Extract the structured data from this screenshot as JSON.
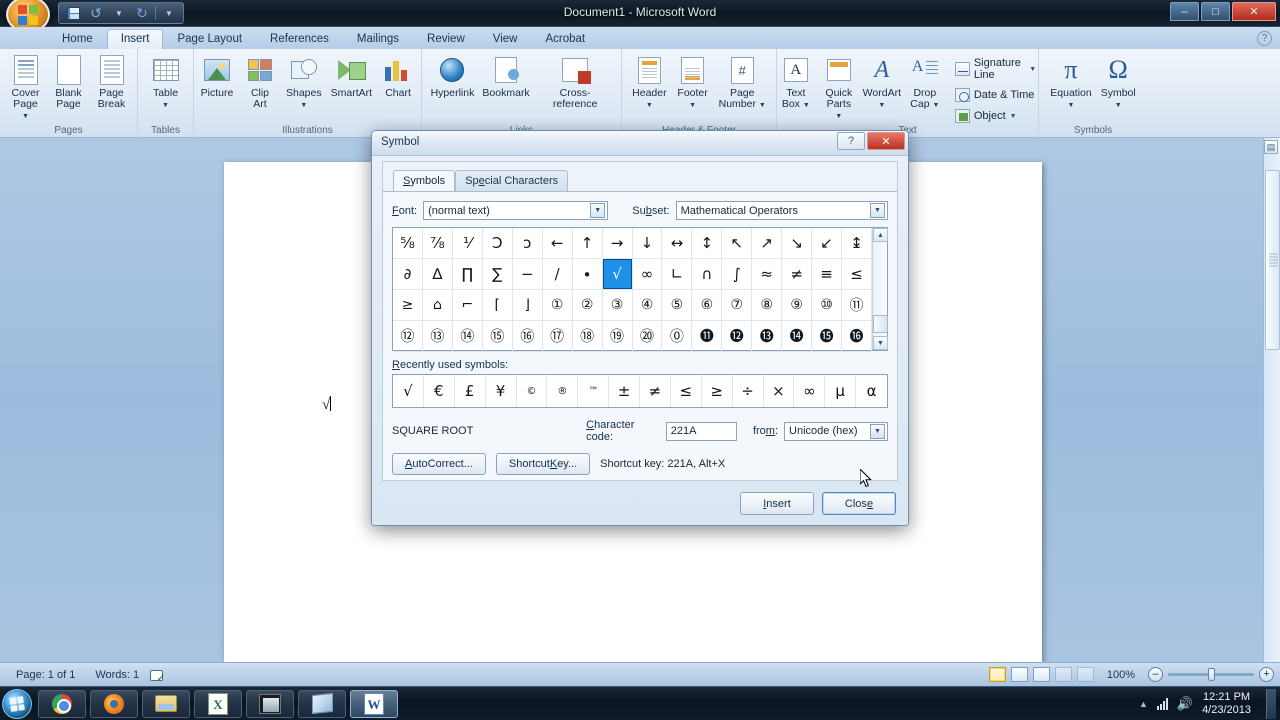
{
  "window": {
    "title": "Document1 - Microsoft Word",
    "minimize": "–",
    "maximize": "□",
    "close": "✕",
    "help": "?"
  },
  "quick_access": {
    "save": "save-icon",
    "undo": "undo-icon",
    "redo": "redo-icon",
    "customize": "customize-icon"
  },
  "ribbon": {
    "tabs": [
      "Home",
      "Insert",
      "Page Layout",
      "References",
      "Mailings",
      "Review",
      "View",
      "Acrobat"
    ],
    "active_tab": "Insert",
    "groups": [
      {
        "name": "Pages",
        "items": [
          "Cover Page",
          "Blank Page",
          "Page Break"
        ]
      },
      {
        "name": "Tables",
        "items": [
          "Table"
        ]
      },
      {
        "name": "Illustrations",
        "items": [
          "Picture",
          "Clip Art",
          "Shapes",
          "SmartArt",
          "Chart"
        ]
      },
      {
        "name": "Links",
        "items": [
          "Hyperlink",
          "Bookmark",
          "Cross-reference"
        ]
      },
      {
        "name": "Header & Footer",
        "items": [
          "Header",
          "Footer",
          "Page Number"
        ]
      },
      {
        "name": "Text",
        "items": [
          "Text Box",
          "Quick Parts",
          "WordArt",
          "Drop Cap",
          "Signature Line",
          "Date & Time",
          "Object"
        ]
      },
      {
        "name": "Symbols",
        "items": [
          "Equation",
          "Symbol"
        ]
      }
    ],
    "labels": {
      "cover_page_l1": "Cover",
      "cover_page_l2": "Page",
      "blank_page_l1": "Blank",
      "blank_page_l2": "Page",
      "page_break_l1": "Page",
      "page_break_l2": "Break",
      "table": "Table",
      "picture": "Picture",
      "clip_art_l1": "Clip",
      "clip_art_l2": "Art",
      "shapes": "Shapes",
      "smartart": "SmartArt",
      "chart": "Chart",
      "hyperlink": "Hyperlink",
      "bookmark": "Bookmark",
      "cross_reference": "Cross-reference",
      "header": "Header",
      "footer": "Footer",
      "page_number_l1": "Page",
      "page_number_l2": "Number",
      "text_box_l1": "Text",
      "text_box_l2": "Box",
      "quick_parts_l1": "Quick",
      "quick_parts_l2": "Parts",
      "wordart": "WordArt",
      "drop_cap_l1": "Drop",
      "drop_cap_l2": "Cap",
      "signature_line": "Signature Line",
      "date_time": "Date & Time",
      "object": "Object",
      "equation": "Equation",
      "symbol": "Symbol"
    },
    "group_names": {
      "pages": "Pages",
      "tables": "Tables",
      "illustrations": "Illustrations",
      "links": "Links",
      "header_footer": "Header & Footer",
      "text": "Text",
      "symbols": "Symbols"
    }
  },
  "document": {
    "text": "√"
  },
  "status_bar": {
    "page": "Page: 1 of 1",
    "words": "Words: 1",
    "proofing": "proofing-errors-icon",
    "zoom_level": "100%",
    "zoom_out": "–",
    "zoom_in": "+",
    "views": [
      "Print Layout",
      "Full Screen Reading",
      "Web Layout",
      "Outline",
      "Draft"
    ]
  },
  "taskbar": {
    "start": "start-orb",
    "items": [
      "Google Chrome",
      "Mozilla Firefox",
      "Windows Explorer",
      "Microsoft Excel",
      "Media Player",
      "Sticky Notes",
      "Microsoft Word"
    ],
    "tray": {
      "show_hidden": "▲",
      "network": "network-icon",
      "volume": "volume-icon"
    },
    "clock_time": "12:21 PM",
    "clock_date": "4/23/2013"
  },
  "dialog": {
    "title": "Symbol",
    "help_btn": "?",
    "close_btn": "✕",
    "tabs": [
      {
        "label": "Symbols",
        "accel": "S",
        "rest": "ymbols",
        "active": true
      },
      {
        "label": "Special Characters",
        "accel": "",
        "rest": "",
        "active": false
      }
    ],
    "tab_symbols_a": "S",
    "tab_symbols_b": "ymbols",
    "tab_special_a": "Sp",
    "tab_special_b": "e",
    "tab_special_c": "cial Characters",
    "font_label_a": "F",
    "font_label_b": "ont:",
    "font_value": "(normal text)",
    "subset_label_a": "Su",
    "subset_label_b": "b",
    "subset_label_c": "set:",
    "subset_value": "Mathematical Operators",
    "dropdown_arrow": "▼",
    "scroll_up": "▲",
    "scroll_down": "▼",
    "grid": {
      "rows": [
        [
          "⅝",
          "⅞",
          "⅟",
          "Ɔ",
          "ɔ",
          "←",
          "↑",
          "→",
          "↓",
          "↔",
          "↕",
          "↖",
          "↗",
          "↘",
          "↙",
          "↨"
        ],
        [
          "∂",
          "∆",
          "∏",
          "∑",
          "−",
          "∕",
          "∙",
          "√",
          "∞",
          "∟",
          "∩",
          "∫",
          "≈",
          "≠",
          "≡",
          "≤"
        ],
        [
          "≥",
          "⌂",
          "⌐",
          "⌈",
          "⌋",
          "①",
          "②",
          "③",
          "④",
          "⑤",
          "⑥",
          "⑦",
          "⑧",
          "⑨",
          "⑩",
          "⑪"
        ],
        [
          "⑫",
          "⑬",
          "⑭",
          "⑮",
          "⑯",
          "⑰",
          "⑱",
          "⑲",
          "⑳",
          "⓪",
          "⓫",
          "⓬",
          "⓭",
          "⓮",
          "⓯",
          "⓰"
        ]
      ],
      "selected_row": 1,
      "selected_col": 7
    },
    "recently_used_label_a": "R",
    "recently_used_label_b": "ecently used symbols:",
    "recently_used": [
      "√",
      "€",
      "£",
      "¥",
      "©",
      "®",
      "™",
      "±",
      "≠",
      "≤",
      "≥",
      "÷",
      "×",
      "∞",
      "µ",
      "α"
    ],
    "symbol_name": "SQUARE ROOT",
    "character_code_label_a": "C",
    "character_code_label_b": "haracter code:",
    "character_code_value": "221A",
    "from_label_a": "fro",
    "from_label_b": "m",
    "from_label_c": ":",
    "from_value": "Unicode (hex)",
    "autocorrect_a": "A",
    "autocorrect_b": "utoCorrect...",
    "shortcut_key_a": "Shortcut ",
    "shortcut_key_b": "K",
    "shortcut_key_c": "ey...",
    "shortcut_text": "Shortcut key: 221A, Alt+X",
    "insert_a": "I",
    "insert_b": "nsert",
    "close_label_a": "Clos",
    "close_label_b": "e"
  }
}
